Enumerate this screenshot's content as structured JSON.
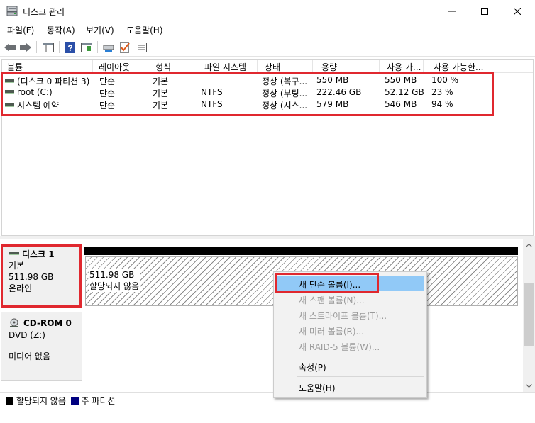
{
  "window": {
    "title": "디스크 관리"
  },
  "menu": [
    "파일(F)",
    "동작(A)",
    "보기(V)",
    "도움말(H)"
  ],
  "columns": [
    "볼륨",
    "레이아웃",
    "형식",
    "파일 시스템",
    "상태",
    "용량",
    "사용 가...",
    "사용 가능한..."
  ],
  "volumes": [
    {
      "name": "(디스크 0 파티션 3)",
      "layout": "단순",
      "type": "기본",
      "fs": "",
      "status": "정상 (복구...",
      "capacity": "550 MB",
      "free": "550 MB",
      "pct": "100 %"
    },
    {
      "name": "root (C:)",
      "layout": "단순",
      "type": "기본",
      "fs": "NTFS",
      "status": "정상 (부팅...",
      "capacity": "222.46 GB",
      "free": "52.12 GB",
      "pct": "23 %"
    },
    {
      "name": "시스템 예약",
      "layout": "단순",
      "type": "기본",
      "fs": "NTFS",
      "status": "정상 (시스...",
      "capacity": "579 MB",
      "free": "546 MB",
      "pct": "94 %"
    }
  ],
  "disk1": {
    "title": "디스크 1",
    "type": "기본",
    "size": "511.98 GB",
    "state": "온라인"
  },
  "unallocated": {
    "size": "511.98 GB",
    "label": "할당되지 않음"
  },
  "cdrom": {
    "title": "CD-ROM 0",
    "drive": "DVD (Z:)",
    "media": "미디어 없음"
  },
  "legend": {
    "unallocated": "할당되지 않음",
    "primary": "주 파티션",
    "unallocated_color": "#000000",
    "primary_color": "#000080"
  },
  "context_menu": {
    "new_simple": "새 단순 볼륨(I)...",
    "new_spanned": "새 스팬 볼륨(N)...",
    "new_striped": "새 스트라이프 볼륨(T)...",
    "new_mirrored": "새 미러 볼륨(R)...",
    "new_raid5": "새 RAID-5 볼륨(W)...",
    "properties": "속성(P)",
    "help": "도움말(H)"
  },
  "colors": {
    "highlight": "#e0282f",
    "menu_hover": "#91c9f7"
  }
}
